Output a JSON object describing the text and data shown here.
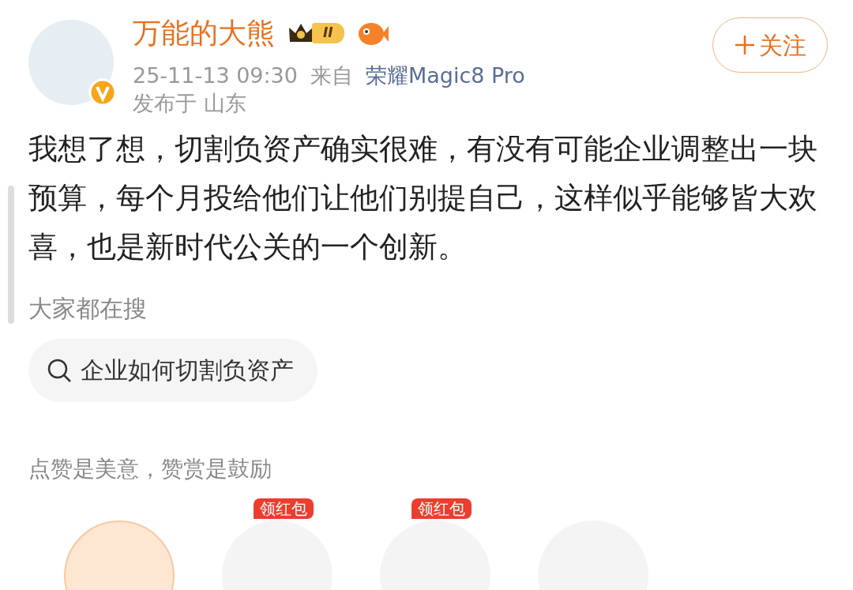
{
  "author": {
    "name": "万能的大熊",
    "level_badge": "II",
    "verified": true
  },
  "follow_button": {
    "label": "关注"
  },
  "meta": {
    "time": "25-11-13 09:30",
    "source_prefix": "来自",
    "source": "荣耀Magic8 Pro",
    "location": "发布于 山东"
  },
  "post": {
    "text": "我想了想，切割负资产确实很难，有没有可能企业调整出一块预算，每个月投给他们让他们别提自己，这样似乎能够皆大欢喜，也是新时代公关的一个创新。"
  },
  "trending": {
    "title": "大家都在搜",
    "items": [
      {
        "label": "企业如何切割负资产"
      }
    ]
  },
  "reward": {
    "caption": "点赞是美意，赞赏是鼓励",
    "options": [
      {
        "selected": true
      },
      {
        "selected": false,
        "badge": "领红包"
      },
      {
        "selected": false,
        "badge": "领红包"
      },
      {
        "selected": false
      }
    ]
  }
}
